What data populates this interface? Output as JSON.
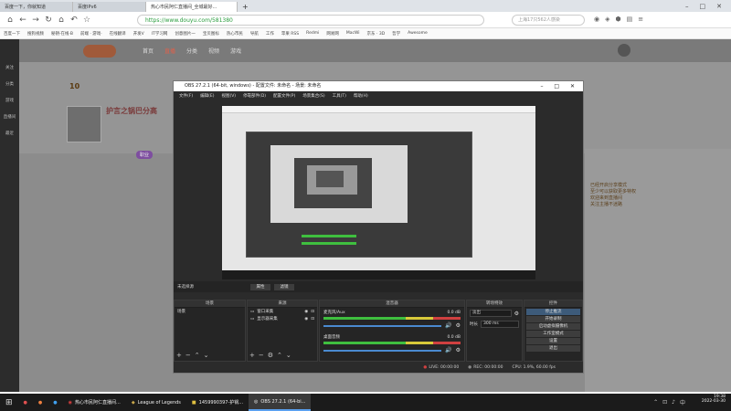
{
  "browser": {
    "tabs": [
      {
        "label": "百度一下，你就知道"
      },
      {
        "label": "百度IPv6"
      },
      {
        "label": "热心市民阿仁直播间_全城最好..."
      }
    ],
    "new_tab_label": "+",
    "url": "https://www.douyu.com/581380",
    "search_placeholder": "上海17只562人感染",
    "bookmarks": [
      {
        "label": "百度一下"
      },
      {
        "label": "搜狗视频"
      },
      {
        "label": "秘钥·在线·B"
      },
      {
        "label": "前端 · 游戏·"
      },
      {
        "label": "在线翻译"
      },
      {
        "label": "开发V"
      },
      {
        "label": "IT学习网"
      },
      {
        "label": "创意图片一"
      },
      {
        "label": "宝贝图标"
      },
      {
        "label": "热心市民"
      },
      {
        "label": "导航"
      },
      {
        "label": "工作"
      },
      {
        "label": "苹果 RSS"
      },
      {
        "label": "Redmi"
      },
      {
        "label": "网易网"
      },
      {
        "label": "MacWi"
      },
      {
        "label": "京东 · 3D"
      },
      {
        "label": "哲学"
      },
      {
        "label": "Awesome"
      }
    ]
  },
  "douyu": {
    "menu": [
      "首页",
      "直播",
      "分类",
      "视频",
      "游戏"
    ],
    "left_nav": [
      "关注",
      "分类",
      "游戏",
      "直播间",
      "最近"
    ],
    "level": "10",
    "streamer_name": "护言之锅巴分高",
    "streamer_tag": "职业",
    "chat_lines": [
      "已经开启分享模式",
      "至少可以获取更多特权",
      "欢迎来到直播间",
      "关注主播不迷路"
    ]
  },
  "obs": {
    "title": "OBS 27.2.1 (64-bit, windows) - 配置文件: 未命名 - 场景: 未命名",
    "menu": [
      "文件(F)",
      "编辑(E)",
      "视图(V)",
      "停靠部件(D)",
      "配置文件(P)",
      "场景集合(S)",
      "工具(T)",
      "帮助(H)"
    ],
    "source_toolbar": [
      "未选择源",
      "属性",
      "滤镜"
    ],
    "docks": {
      "scenes": {
        "title": "场景",
        "items": [
          "场景"
        ]
      },
      "sources": {
        "title": "来源",
        "items": [
          "窗口采集",
          "显示器采集"
        ]
      },
      "mixer": {
        "title": "混音器",
        "channels": [
          {
            "name": "麦克风/Aux",
            "db": "0.0 dB"
          },
          {
            "name": "桌面音频",
            "db": "0.0 dB"
          }
        ]
      },
      "transitions": {
        "title": "转场特效",
        "type": "淡出",
        "duration_label": "时长",
        "duration": "300 ms"
      },
      "controls": {
        "title": "控件",
        "buttons": [
          "停止推流",
          "开始录制",
          "启动虚拟摄像机",
          "工作室模式",
          "设置",
          "退出"
        ]
      }
    },
    "status": {
      "live": "LIVE: 00:00:00",
      "rec": "REC: 00:00:00",
      "cpu": "CPU: 1.9%, 60.00 fps"
    },
    "colors": {
      "active_button": "#3d5b7a",
      "meter_green": "#3fbf3f",
      "meter_yellow": "#d8c93a",
      "meter_red": "#d04040"
    }
  },
  "taskbar": {
    "items": [
      {
        "label": "热心市民阿仁直播间..."
      },
      {
        "label": "League of Legends"
      },
      {
        "label": "1459990397-护锅..."
      },
      {
        "label": "OBS 27.2.1 (64-bi..."
      }
    ],
    "time": "19:38",
    "date": "2022-03-30"
  }
}
